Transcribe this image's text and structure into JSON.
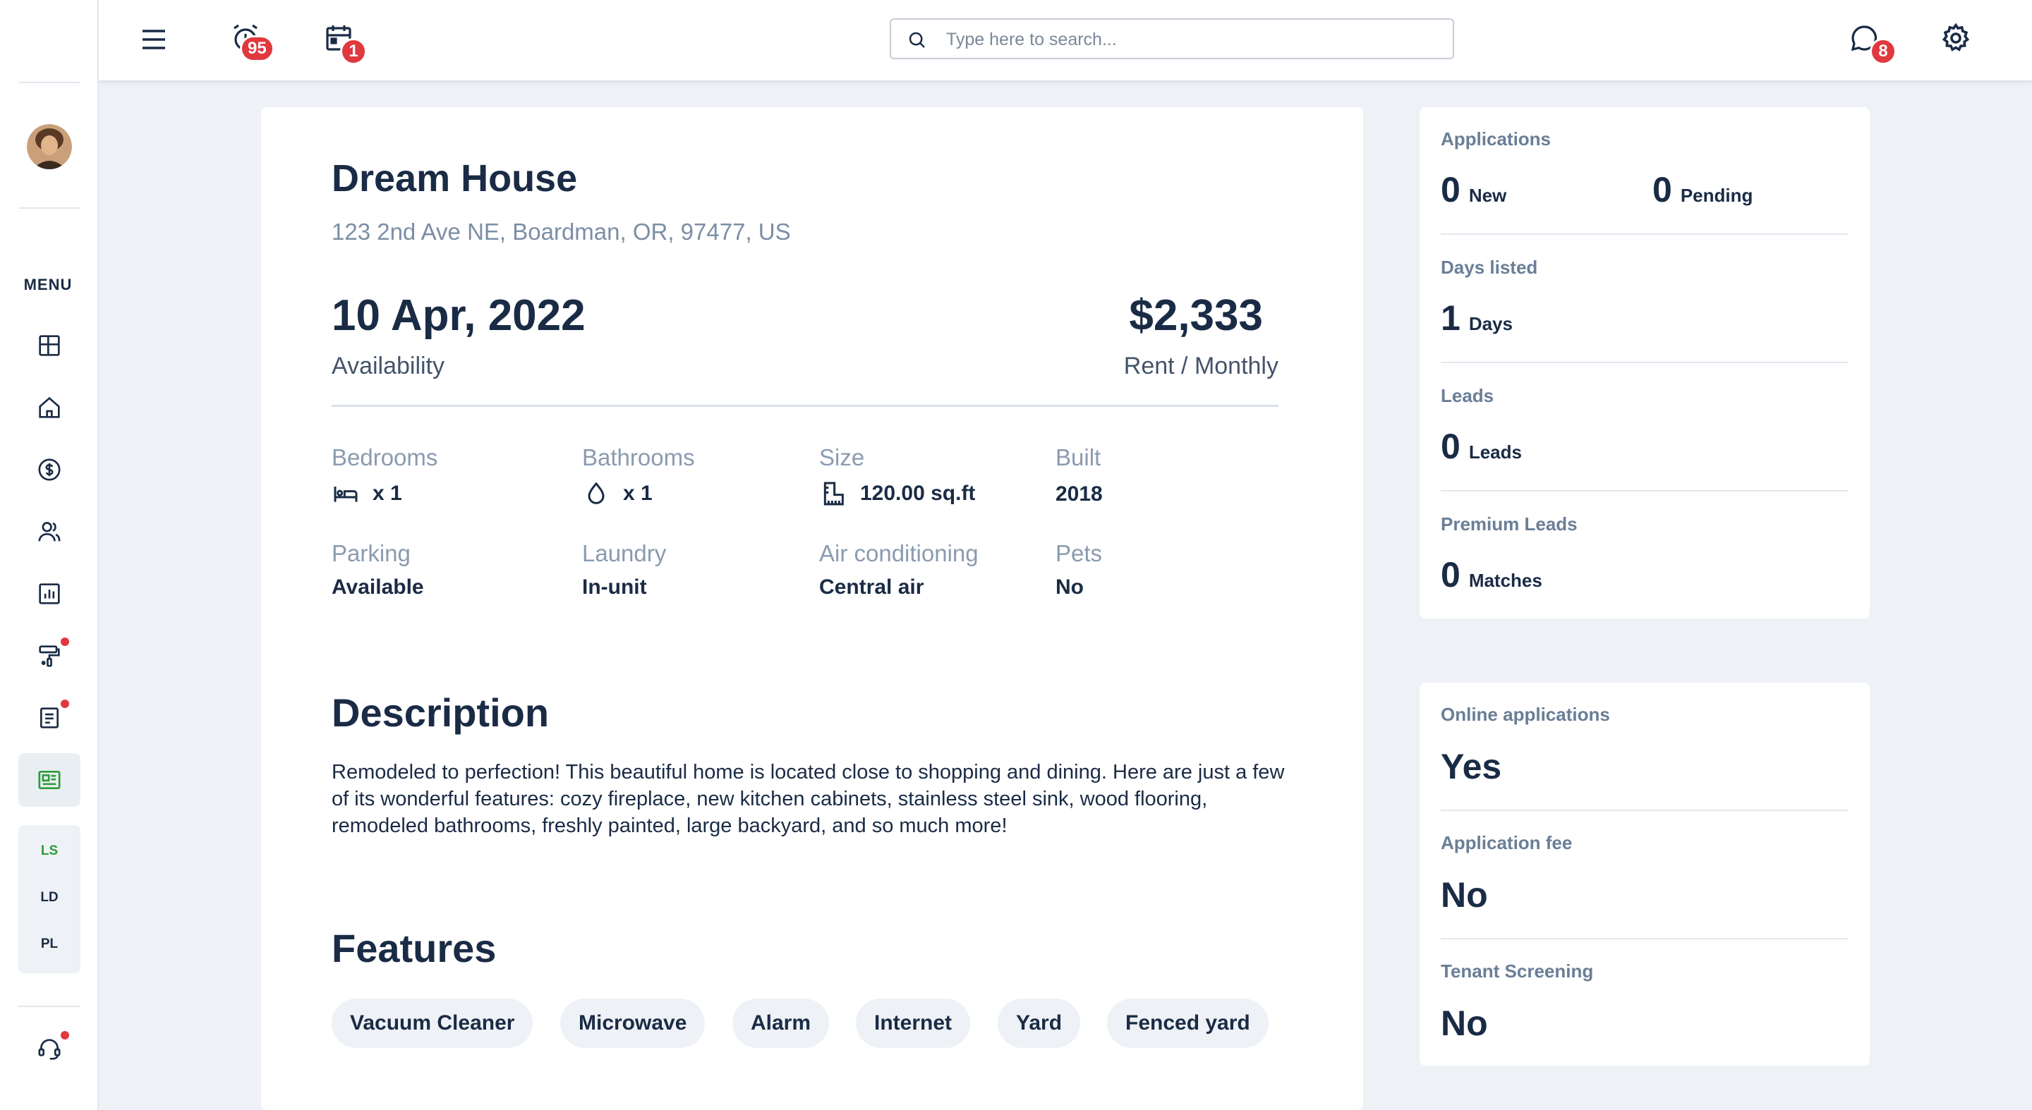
{
  "sidebar": {
    "menu_label": "MENU",
    "icons": [
      "dashboard-icon",
      "home-icon",
      "dollar-icon",
      "users-icon",
      "bar-chart-icon",
      "paint-roller-icon",
      "document-icon",
      "listing-icon"
    ],
    "sub_items": [
      "LS",
      "LD",
      "PL"
    ],
    "support_icon": "headset-icon"
  },
  "topbar": {
    "alarm_badge": "95",
    "calendar_badge": "1",
    "messages_badge": "8",
    "search_placeholder": "Type here to search..."
  },
  "property": {
    "title": "Dream House",
    "address": "123 2nd Ave NE, Boardman, OR, 97477, US",
    "availability_date": "10 Apr, 2022",
    "availability_label": "Availability",
    "price": "$2,333",
    "price_label": "Rent / Monthly"
  },
  "specs": {
    "bedrooms": {
      "label": "Bedrooms",
      "value": "x 1"
    },
    "bathrooms": {
      "label": "Bathrooms",
      "value": "x 1"
    },
    "size": {
      "label": "Size",
      "value": "120.00 sq.ft"
    },
    "built": {
      "label": "Built",
      "value": "2018"
    },
    "parking": {
      "label": "Parking",
      "value": "Available"
    },
    "laundry": {
      "label": "Laundry",
      "value": "In-unit"
    },
    "ac": {
      "label": "Air conditioning",
      "value": "Central air"
    },
    "pets": {
      "label": "Pets",
      "value": "No"
    }
  },
  "description": {
    "title": "Description",
    "text": "Remodeled to perfection! This beautiful home is located close to shopping and dining. Here are just a few of its wonderful features: cozy fireplace, new kitchen cabinets, stainless steel sink, wood flooring, remodeled bathrooms, freshly painted, large backyard, and so much more!"
  },
  "features": {
    "title": "Features",
    "items": [
      "Vacuum Cleaner",
      "Microwave",
      "Alarm",
      "Internet",
      "Yard",
      "Fenced yard"
    ]
  },
  "stats": {
    "applications": {
      "label": "Applications",
      "new_count": "0",
      "new_label": "New",
      "pending_count": "0",
      "pending_label": "Pending"
    },
    "days_listed": {
      "label": "Days listed",
      "count": "1",
      "unit": "Days"
    },
    "leads": {
      "label": "Leads",
      "count": "0",
      "unit": "Leads"
    },
    "premium_leads": {
      "label": "Premium Leads",
      "count": "0",
      "unit": "Matches"
    }
  },
  "settings": {
    "online_applications": {
      "label": "Online applications",
      "value": "Yes"
    },
    "application_fee": {
      "label": "Application fee",
      "value": "No"
    },
    "tenant_screening": {
      "label": "Tenant Screening",
      "value": "No"
    }
  },
  "colors": {
    "accent_green": "#2e9b3a",
    "badge_red": "#e0383e",
    "text_dark": "#1a2b45",
    "background": "#eef1f5"
  }
}
